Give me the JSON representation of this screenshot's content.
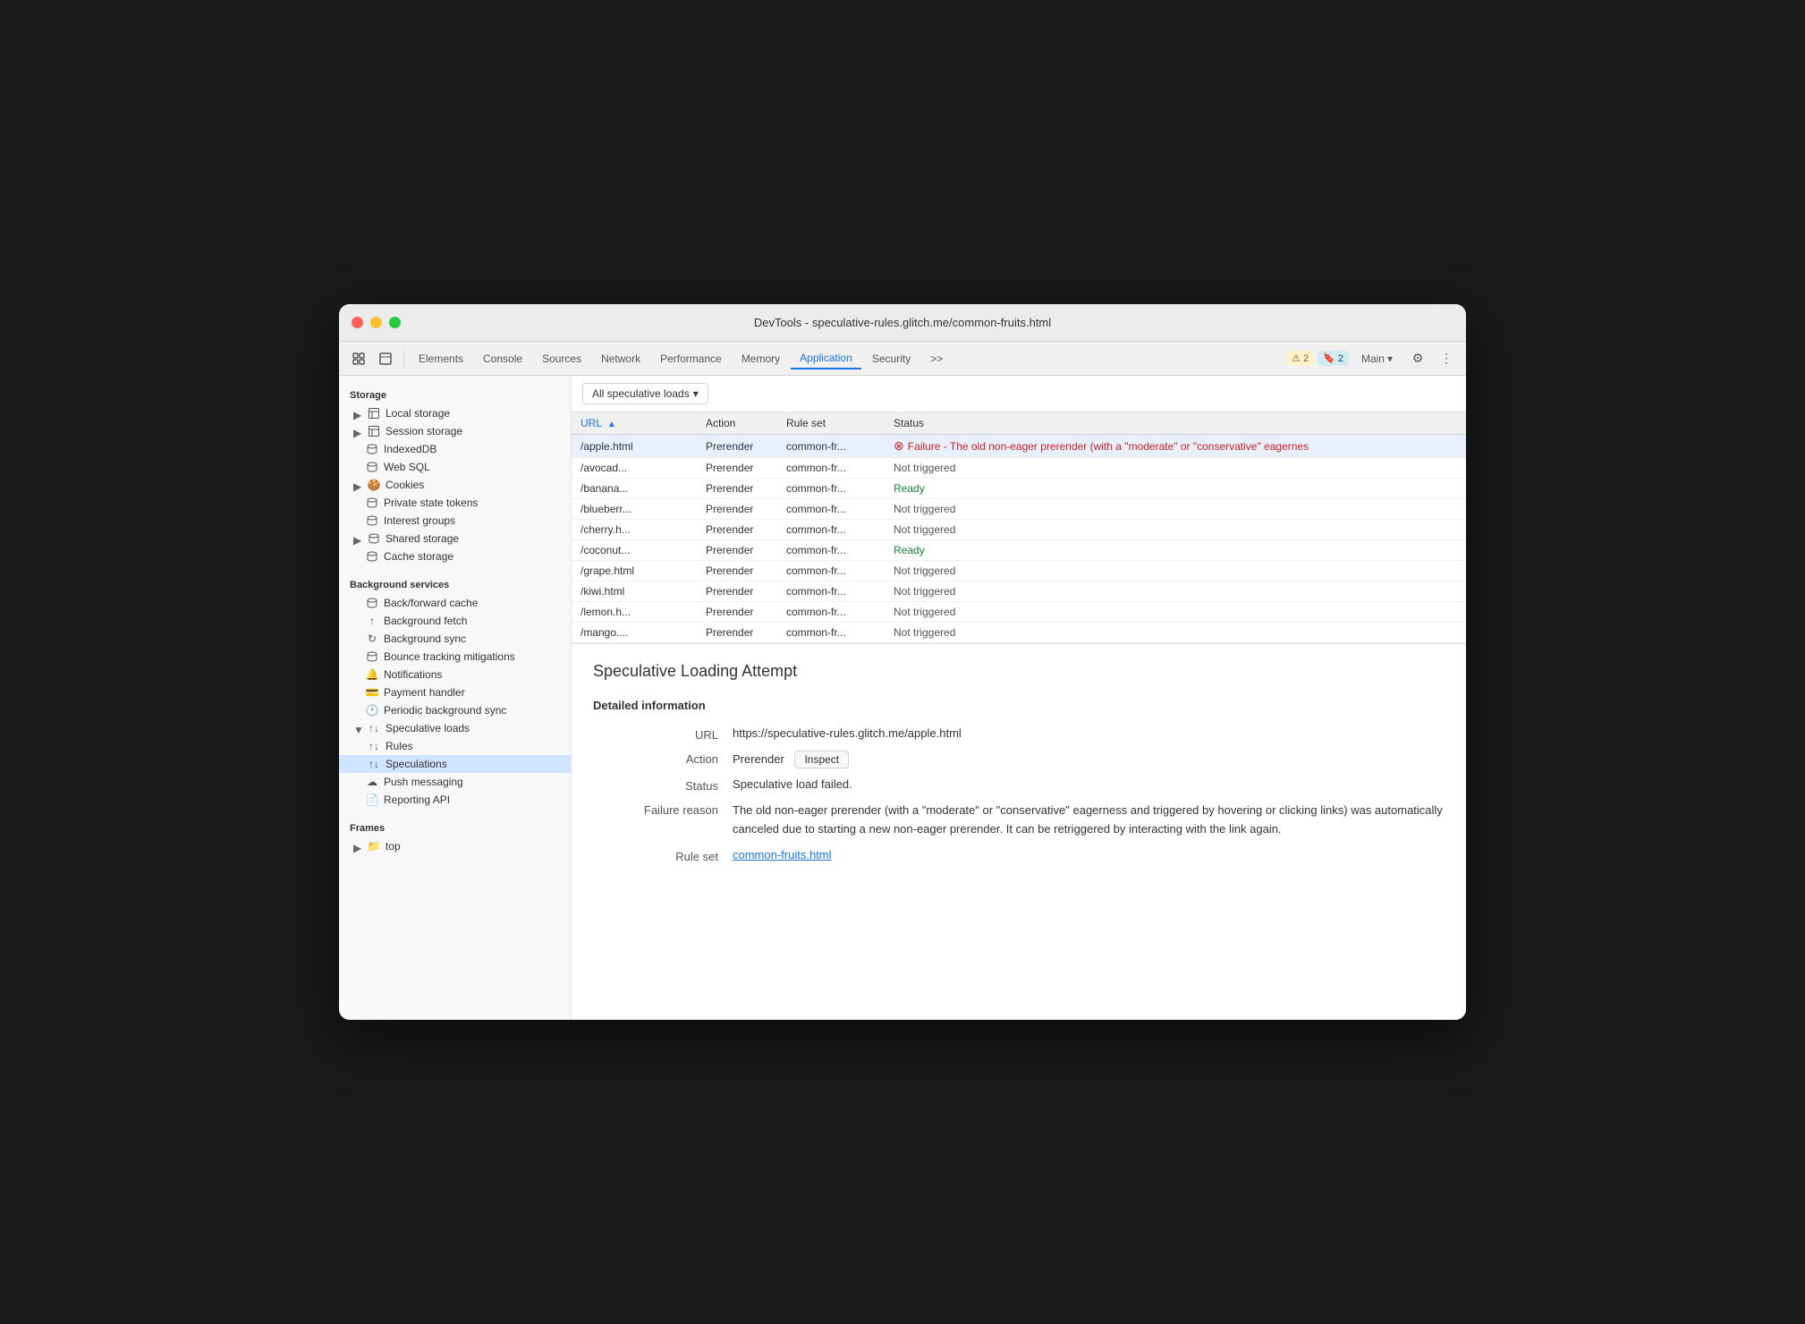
{
  "window": {
    "title": "DevTools - speculative-rules.glitch.me/common-fruits.html"
  },
  "toolbar": {
    "tabs": [
      {
        "id": "elements",
        "label": "Elements"
      },
      {
        "id": "console",
        "label": "Console"
      },
      {
        "id": "sources",
        "label": "Sources"
      },
      {
        "id": "network",
        "label": "Network"
      },
      {
        "id": "performance",
        "label": "Performance"
      },
      {
        "id": "memory",
        "label": "Memory"
      },
      {
        "id": "application",
        "label": "Application"
      },
      {
        "id": "security",
        "label": "Security"
      }
    ],
    "more_tabs": ">>",
    "warn_count": "2",
    "info_count": "2",
    "main_label": "Main",
    "settings_tooltip": "Settings",
    "more_options": "⋮"
  },
  "sidebar": {
    "storage_header": "Storage",
    "items_storage": [
      {
        "id": "local-storage",
        "label": "Local storage",
        "icon": "table",
        "expandable": true,
        "level": 0
      },
      {
        "id": "session-storage",
        "label": "Session storage",
        "icon": "table",
        "expandable": true,
        "level": 0
      },
      {
        "id": "indexeddb",
        "label": "IndexedDB",
        "icon": "db",
        "expandable": false,
        "level": 0
      },
      {
        "id": "web-sql",
        "label": "Web SQL",
        "icon": "db",
        "expandable": false,
        "level": 0
      },
      {
        "id": "cookies",
        "label": "Cookies",
        "icon": "cookie",
        "expandable": true,
        "level": 0
      },
      {
        "id": "private-state-tokens",
        "label": "Private state tokens",
        "icon": "db",
        "expandable": false,
        "level": 0
      },
      {
        "id": "interest-groups",
        "label": "Interest groups",
        "icon": "db",
        "expandable": false,
        "level": 0
      },
      {
        "id": "shared-storage",
        "label": "Shared storage",
        "icon": "db",
        "expandable": true,
        "level": 0
      },
      {
        "id": "cache-storage",
        "label": "Cache storage",
        "icon": "db",
        "expandable": false,
        "level": 0
      }
    ],
    "bg_services_header": "Background services",
    "items_bg": [
      {
        "id": "back-forward-cache",
        "label": "Back/forward cache",
        "icon": "db",
        "level": 0
      },
      {
        "id": "background-fetch",
        "label": "Background fetch",
        "icon": "sync",
        "level": 0
      },
      {
        "id": "background-sync",
        "label": "Background sync",
        "icon": "sync2",
        "level": 0
      },
      {
        "id": "bounce-tracking",
        "label": "Bounce tracking mitigations",
        "icon": "db",
        "level": 0
      },
      {
        "id": "notifications",
        "label": "Notifications",
        "icon": "bell",
        "level": 0
      },
      {
        "id": "payment-handler",
        "label": "Payment handler",
        "icon": "card",
        "level": 0
      },
      {
        "id": "periodic-bg-sync",
        "label": "Periodic background sync",
        "icon": "clock",
        "level": 0
      },
      {
        "id": "speculative-loads",
        "label": "Speculative loads",
        "icon": "sync",
        "expandable": true,
        "expanded": true,
        "level": 0
      },
      {
        "id": "rules",
        "label": "Rules",
        "icon": "sync",
        "level": 1
      },
      {
        "id": "speculations",
        "label": "Speculations",
        "icon": "sync",
        "level": 1,
        "active": true
      },
      {
        "id": "push-messaging",
        "label": "Push messaging",
        "icon": "cloud",
        "level": 0
      },
      {
        "id": "reporting-api",
        "label": "Reporting API",
        "icon": "doc",
        "level": 0
      }
    ],
    "frames_header": "Frames",
    "items_frames": [
      {
        "id": "top",
        "label": "top",
        "icon": "folder",
        "expandable": true,
        "level": 0
      }
    ]
  },
  "content": {
    "filter_label": "All speculative loads",
    "table": {
      "columns": [
        {
          "id": "url",
          "label": "URL",
          "sorted": true
        },
        {
          "id": "action",
          "label": "Action"
        },
        {
          "id": "ruleset",
          "label": "Rule set"
        },
        {
          "id": "status",
          "label": "Status"
        }
      ],
      "rows": [
        {
          "url": "/apple.html",
          "action": "Prerender",
          "ruleset": "common-fr...",
          "status": "failure",
          "status_text": "Failure - The old non-eager prerender (with a \"moderate\" or \"conservative\" eagernes",
          "selected": true
        },
        {
          "url": "/avocad...",
          "action": "Prerender",
          "ruleset": "common-fr...",
          "status": "not-triggered",
          "status_text": "Not triggered"
        },
        {
          "url": "/banana...",
          "action": "Prerender",
          "ruleset": "common-fr...",
          "status": "ready",
          "status_text": "Ready"
        },
        {
          "url": "/blueberr...",
          "action": "Prerender",
          "ruleset": "common-fr...",
          "status": "not-triggered",
          "status_text": "Not triggered"
        },
        {
          "url": "/cherry.h...",
          "action": "Prerender",
          "ruleset": "common-fr...",
          "status": "not-triggered",
          "status_text": "Not triggered"
        },
        {
          "url": "/coconut...",
          "action": "Prerender",
          "ruleset": "common-fr...",
          "status": "ready",
          "status_text": "Ready"
        },
        {
          "url": "/grape.html",
          "action": "Prerender",
          "ruleset": "common-fr...",
          "status": "not-triggered",
          "status_text": "Not triggered"
        },
        {
          "url": "/kiwi.html",
          "action": "Prerender",
          "ruleset": "common-fr...",
          "status": "not-triggered",
          "status_text": "Not triggered"
        },
        {
          "url": "/lemon.h...",
          "action": "Prerender",
          "ruleset": "common-fr...",
          "status": "not-triggered",
          "status_text": "Not triggered"
        },
        {
          "url": "/mango....",
          "action": "Prerender",
          "ruleset": "common-fr...",
          "status": "not-triggered",
          "status_text": "Not triggered"
        }
      ]
    },
    "detail": {
      "title": "Speculative Loading Attempt",
      "section_header": "Detailed information",
      "fields": {
        "url_label": "URL",
        "url_value": "https://speculative-rules.glitch.me/apple.html",
        "action_label": "Action",
        "action_value": "Prerender",
        "inspect_label": "Inspect",
        "status_label": "Status",
        "status_value": "Speculative load failed.",
        "failure_label": "Failure reason",
        "failure_value": "The old non-eager prerender (with a \"moderate\" or \"conservative\" eagerness and triggered by hovering or clicking links) was automatically canceled due to starting a new non-eager prerender. It can be retriggered by interacting with the link again.",
        "ruleset_label": "Rule set",
        "ruleset_value": "common-fruits.html",
        "ruleset_link": "common-fruits.html"
      }
    }
  }
}
